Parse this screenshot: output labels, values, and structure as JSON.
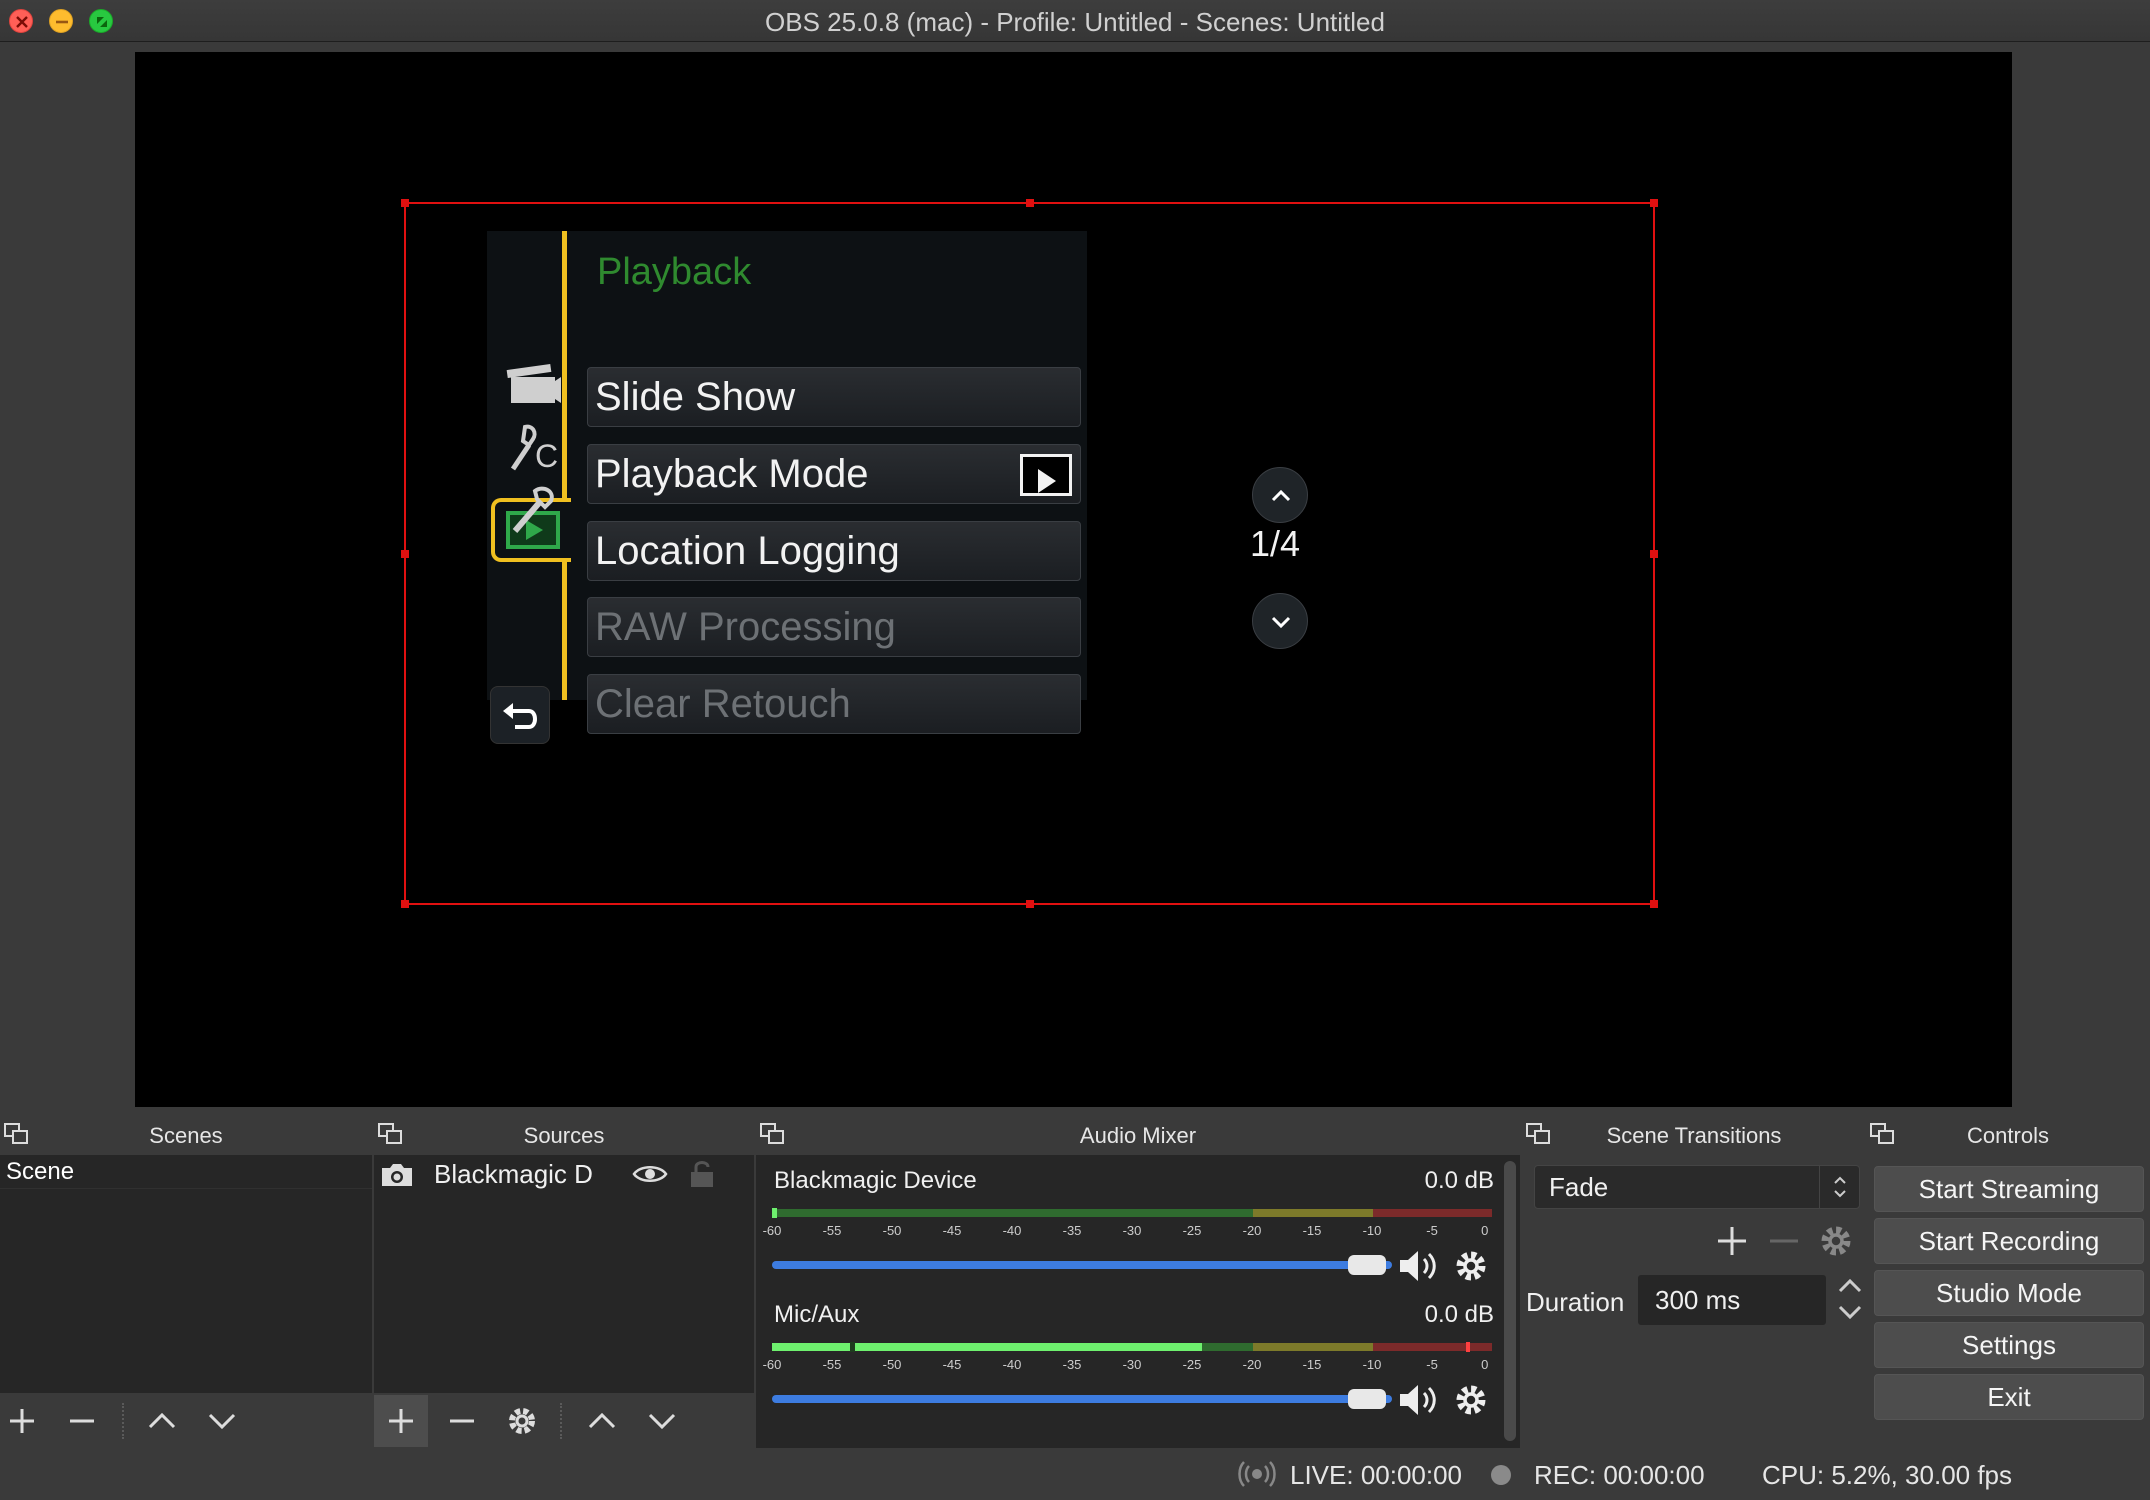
{
  "window": {
    "title": "OBS 25.0.8 (mac) - Profile: Untitled - Scenes: Untitled"
  },
  "preview": {
    "camera_menu": {
      "heading": "Playback",
      "items": [
        {
          "label": "Slide Show"
        },
        {
          "label": "Playback Mode"
        },
        {
          "label": "Location Logging"
        },
        {
          "label": "RAW Processing"
        },
        {
          "label": "Clear Retouch"
        }
      ],
      "page": "1/4",
      "side_icons": [
        "movie-camera-icon",
        "custom-wrench-icon",
        "wrench-icon",
        "playback-icon"
      ],
      "accent_color": "#f0c020",
      "heading_color": "#2f8a2f"
    },
    "selection_color": "#e01010"
  },
  "docks": {
    "scenes": {
      "title": "Scenes",
      "items": [
        "Scene"
      ]
    },
    "sources": {
      "title": "Sources",
      "items": [
        {
          "name": "Blackmagic De’",
          "visible": true,
          "locked": false
        }
      ]
    },
    "audio_mixer": {
      "title": "Audio Mixer",
      "channels": [
        {
          "name": "Blackmagic Device",
          "db": "0.0 dB",
          "volume": 1.0
        },
        {
          "name": "Mic/Aux",
          "db": "0.0 dB",
          "volume": 1.0
        }
      ],
      "scale": [
        "-60",
        "-55",
        "-50",
        "-45",
        "-40",
        "-35",
        "-30",
        "-25",
        "-20",
        "-15",
        "-10",
        "-5",
        "0"
      ]
    },
    "scene_transitions": {
      "title": "Scene Transitions",
      "selected": "Fade",
      "duration_label": "Duration",
      "duration_value": "300 ms"
    },
    "controls": {
      "title": "Controls",
      "buttons": [
        "Start Streaming",
        "Start Recording",
        "Studio Mode",
        "Settings",
        "Exit"
      ]
    }
  },
  "status": {
    "live": "LIVE: 00:00:00",
    "rec": "REC: 00:00:00",
    "cpu": "CPU: 5.2%, 30.00 fps"
  }
}
